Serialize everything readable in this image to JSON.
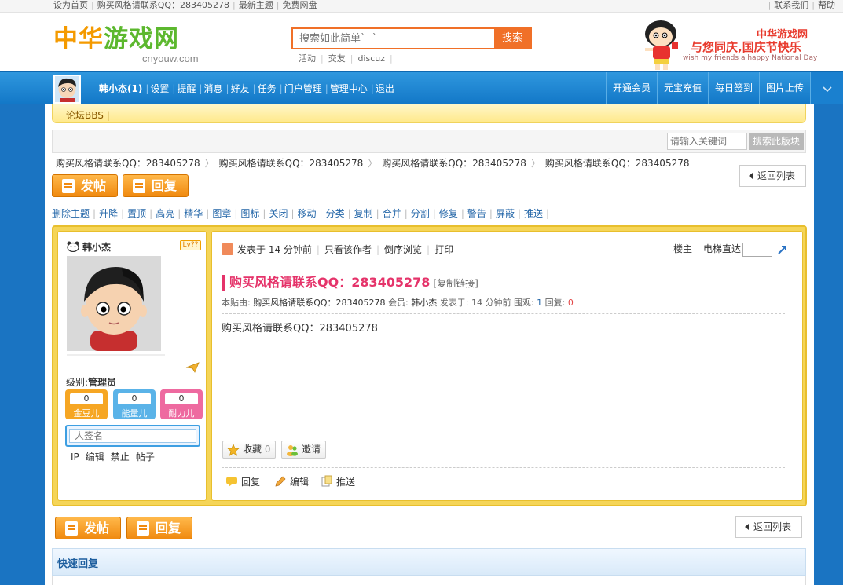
{
  "topbar": {
    "left": [
      "设为首页",
      "购买风格请联系QQ：283405278",
      "最新主题",
      "免费网盘"
    ],
    "right": [
      "联系我们",
      "帮助"
    ]
  },
  "logo": {
    "name_a": "中华",
    "name_b": "游戏网",
    "domain": "cnyouw.com"
  },
  "search": {
    "placeholder": "搜索如此简单`  `",
    "button": "搜索",
    "hotwords": [
      "活动",
      "交友",
      "discuz"
    ]
  },
  "banner": {
    "line1": "中华游戏网",
    "line2": "与您同庆,国庆节快乐",
    "line3": "wish my friends a happy National Day"
  },
  "nav": {
    "username": "韩小杰(1)",
    "links": [
      "设置",
      "提醒",
      "消息",
      "好友",
      "任务",
      "门户管理",
      "管理中心",
      "退出"
    ],
    "right": [
      "开通会员",
      "元宝充值",
      "每日签到",
      "图片上传"
    ]
  },
  "subnav": {
    "label": "论坛BBS"
  },
  "forum_search": {
    "placeholder": "请输入关键词",
    "button": "搜索此版块"
  },
  "breadcrumb": [
    "购买风格请联系QQ：283405278",
    "购买风格请联系QQ：283405278",
    "购买风格请联系QQ：283405278",
    "购买风格请联系QQ：283405278"
  ],
  "actions": {
    "post": "发帖",
    "reply": "回复",
    "back": "返回列表"
  },
  "mod_tools": [
    "删除主题",
    "升降",
    "置顶",
    "高亮",
    "精华",
    "图章",
    "图标",
    "关闭",
    "移动",
    "分类",
    "复制",
    "合并",
    "分割",
    "修复",
    "警告",
    "屏蔽",
    "推送"
  ],
  "author": {
    "name": "韩小杰",
    "level_badge": "Lv??",
    "level_label": "级别:",
    "level_value": "管理员",
    "stats": [
      {
        "value": "0",
        "label": "金豆儿",
        "color": "#f6a623"
      },
      {
        "value": "0",
        "label": "能量儿",
        "color": "#5ab3e8"
      },
      {
        "value": "0",
        "label": "耐力儿",
        "color": "#ee6aa0"
      }
    ],
    "signature_placeholder": "人签名",
    "links": [
      "IP",
      "编辑",
      "禁止",
      "帖子"
    ]
  },
  "post": {
    "posted": "发表于 14 分钟前",
    "view_author": "只看该作者",
    "reverse": "倒序浏览",
    "print": "打印",
    "floor": "楼主",
    "elevator": "电梯直达",
    "title": "购买风格请联系QQ：283405278",
    "copy_link": "[复制链接]",
    "meta_prefix": "本贴由:",
    "meta_poster": "购买风格请联系QQ：283405278",
    "meta_member": "会员:",
    "meta_member_name": "韩小杰",
    "meta_posted": "发表于: 14 分钟前",
    "meta_views_label": "围观:",
    "meta_views": "1",
    "meta_replies_label": "回复:",
    "meta_replies": "0",
    "body": "购买风格请联系QQ：283405278",
    "fav_label": "收藏",
    "fav_count": "0",
    "invite": "邀请",
    "foot": [
      "回复",
      "编辑",
      "推送"
    ]
  },
  "quick_reply": {
    "title": "快速回复"
  },
  "colors": {
    "nav_blue": "#1a80cf",
    "accent_orange": "#f08a10",
    "title_pink": "#e5336a",
    "post_border": "#e8bf2e"
  }
}
